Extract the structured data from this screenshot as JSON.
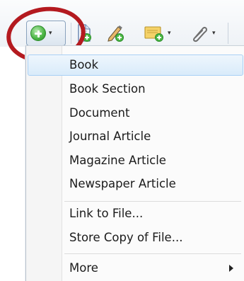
{
  "toolbar": {
    "buttons": [
      {
        "name": "new-item",
        "icon": "green-plus-circle-icon",
        "has_dropdown": true
      },
      {
        "name": "new-item-from-identifier",
        "icon": "document-plus-icon",
        "has_dropdown": false
      },
      {
        "name": "new-note-pen",
        "icon": "pen-plus-icon",
        "has_dropdown": false
      },
      {
        "name": "new-note",
        "icon": "note-plus-icon",
        "has_dropdown": true
      },
      {
        "name": "attachment",
        "icon": "paperclip-icon",
        "has_dropdown": true
      }
    ]
  },
  "menu": {
    "items": [
      {
        "label": "Book",
        "highlighted": true
      },
      {
        "label": "Book Section"
      },
      {
        "label": "Document"
      },
      {
        "label": "Journal Article"
      },
      {
        "label": "Magazine Article"
      },
      {
        "label": "Newspaper Article"
      },
      {
        "label": "Link to File..."
      },
      {
        "label": "Store Copy of File..."
      },
      {
        "label": "More",
        "has_submenu": true
      }
    ]
  },
  "colors": {
    "annotation_ring": "#b41a1f",
    "highlight_bg": "#d9ebfa",
    "highlight_border": "#a9d0f5",
    "plus_icon": "#49b443"
  }
}
